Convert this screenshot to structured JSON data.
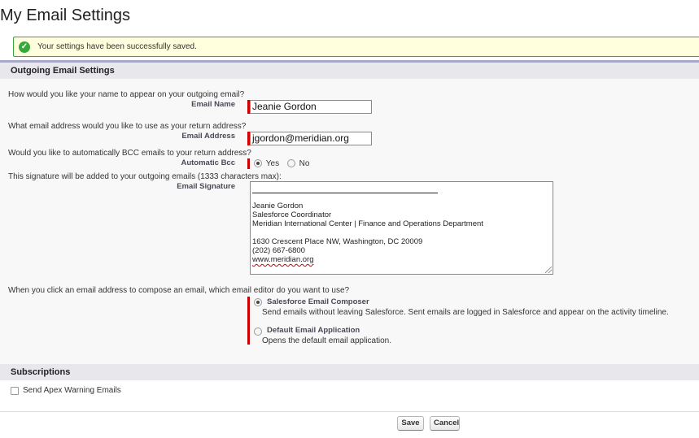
{
  "page": {
    "title": "My Email Settings"
  },
  "alert": {
    "message": "Your settings have been successfully saved."
  },
  "outgoing": {
    "header": "Outgoing Email Settings",
    "name_question": "How would you like your name to appear on your outgoing email?",
    "name_label": "Email Name",
    "name_value": "Jeanie Gordon",
    "address_question": "What email address would you like to use as your return address?",
    "address_label": "Email Address",
    "address_value": "jgordon@meridian.org",
    "bcc_question": "Would you like to automatically BCC emails to your return address?",
    "bcc_label": "Automatic Bcc",
    "bcc_yes": "Yes",
    "bcc_no": "No",
    "bcc_selected": "Yes",
    "sig_question": "This signature will be added to your outgoing emails (1333 characters max):",
    "sig_label": "Email Signature",
    "sig_lines": [
      "Jeanie Gordon",
      "Salesforce Coordinator",
      "Meridian International Center | Finance and Operations Department",
      "",
      "1630 Crescent Place NW, Washington, DC 20009",
      "(202) 667-6800",
      "www.meridian.org"
    ],
    "editor_question": "When you click an email address to compose an email, which email editor do you want to use?",
    "editor_options": [
      {
        "title": "Salesforce Email Composer",
        "desc": "Send emails without leaving Salesforce. Sent emails are logged in Salesforce and appear on the activity timeline.",
        "selected": true
      },
      {
        "title": "Default Email Application",
        "desc": "Opens the default email application.",
        "selected": false
      }
    ]
  },
  "subscriptions": {
    "header": "Subscriptions",
    "apex_label": "Send Apex Warning Emails",
    "apex_checked": false
  },
  "buttons": {
    "save": "Save",
    "cancel": "Cancel"
  },
  "colors": {
    "success_border": "#39a83a",
    "success_bg": "#ffffdd",
    "required": "#cc0000"
  },
  "icons": {
    "success": "check-circle-icon",
    "resize": "resize-grip-icon"
  }
}
